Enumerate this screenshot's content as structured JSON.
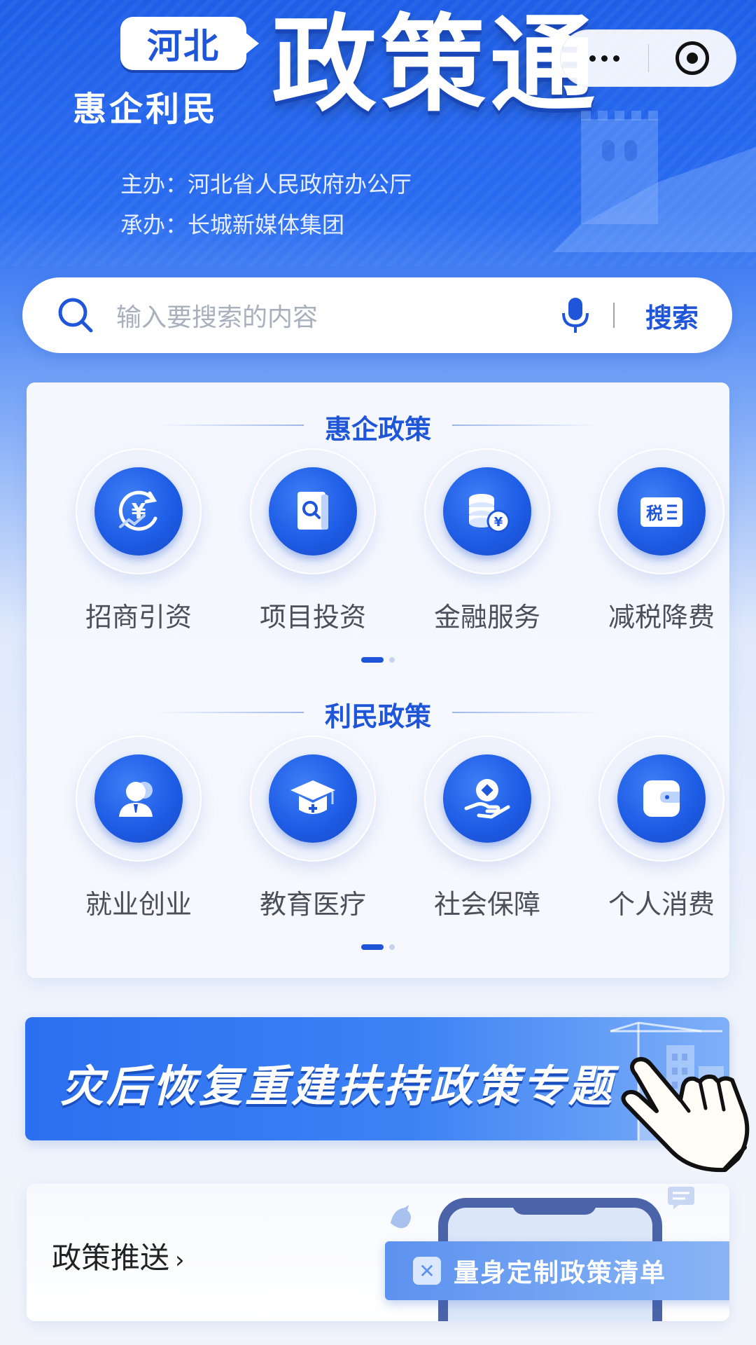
{
  "header": {
    "badge": "河北",
    "tagline": "惠企利民",
    "title": "政策通",
    "sponsor_line": "主办：河北省人民政府办公厅",
    "organizer_line": "承办：长城新媒体集团"
  },
  "capsule": {
    "more_icon": "more-dots-icon",
    "close_icon": "target-circle-icon"
  },
  "search": {
    "placeholder": "输入要搜索的内容",
    "button": "搜索"
  },
  "enterprise": {
    "title": "惠企政策",
    "items": [
      {
        "label": "招商引资",
        "icon": "yuan-cycle-icon"
      },
      {
        "label": "项目投资",
        "icon": "document-search-icon"
      },
      {
        "label": "金融服务",
        "icon": "coins-icon"
      },
      {
        "label": "减税降费",
        "icon": "tax-icon"
      }
    ],
    "page": 1,
    "pages": 2
  },
  "people": {
    "title": "利民政策",
    "items": [
      {
        "label": "就业创业",
        "icon": "user-icon"
      },
      {
        "label": "教育医疗",
        "icon": "graduation-cap-icon"
      },
      {
        "label": "社会保障",
        "icon": "hand-protect-icon"
      },
      {
        "label": "个人消费",
        "icon": "wallet-icon"
      }
    ],
    "page": 1,
    "pages": 2
  },
  "banner": {
    "text": "灾后恢复重建扶持政策专题"
  },
  "push": {
    "title": "政策推送",
    "chevron": "›",
    "cta_icon": "✕",
    "cta": "量身定制政策清单"
  },
  "colors": {
    "brand_blue": "#1f55d8",
    "header_blue": "#2a6cf0"
  }
}
